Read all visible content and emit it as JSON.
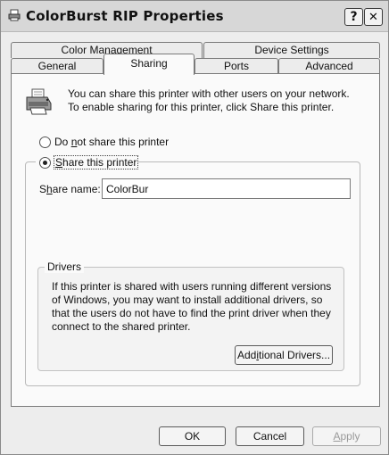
{
  "window": {
    "title": "ColorBurst RIP Properties",
    "help_button": "?",
    "close_button": "✕"
  },
  "tabs": {
    "row1": [
      {
        "label": "Color Management"
      },
      {
        "label": "Device Settings"
      }
    ],
    "row2": [
      {
        "label": "General"
      },
      {
        "label": "Sharing",
        "active": true
      },
      {
        "label": "Ports"
      },
      {
        "label": "Advanced"
      }
    ]
  },
  "sharing": {
    "intro_text": "You can share this printer with other users on your network. To enable sharing for this printer, click Share this printer.",
    "do_not_share": {
      "pre": "Do ",
      "underline": "n",
      "post": "ot share this printer",
      "selected": false
    },
    "share": {
      "pre": "",
      "underline": "S",
      "post": "hare this printer",
      "selected": true
    },
    "share_name_label": {
      "pre": "S",
      "underline": "h",
      "post": "are name:"
    },
    "share_name_value": "ColorBur"
  },
  "drivers": {
    "legend": "Drivers",
    "text": "If this printer is shared with users running different versions of Windows, you may want to install additional drivers, so that the users do not have to find the print driver when they connect to the shared printer.",
    "button": {
      "pre": "Add",
      "underline": "i",
      "post": "tional Drivers..."
    }
  },
  "footer": {
    "ok": "OK",
    "cancel": "Cancel",
    "apply": {
      "underline": "A",
      "post": "pply",
      "enabled": false
    }
  },
  "icons": {
    "title_icon": "printer-icon",
    "printer_icon": "printer-icon"
  }
}
